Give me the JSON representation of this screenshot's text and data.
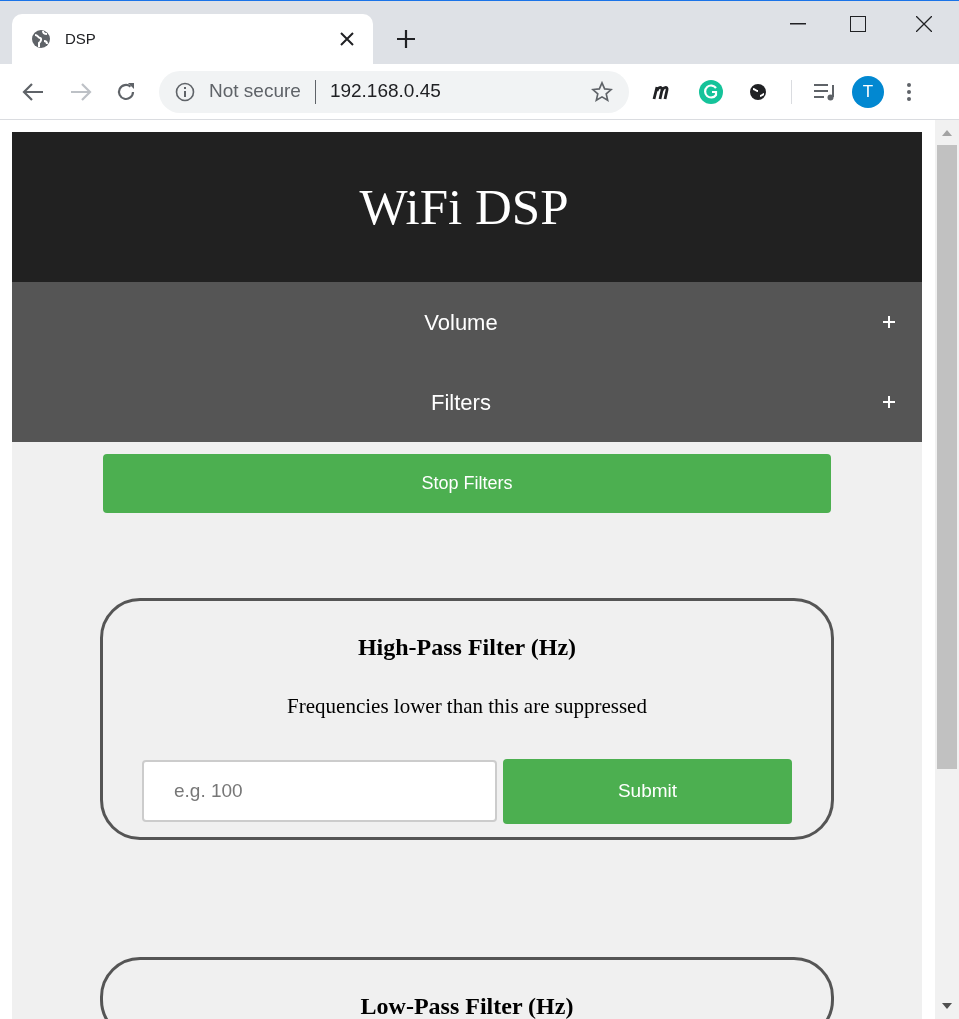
{
  "browser": {
    "tab": {
      "title": "DSP"
    },
    "address_bar": {
      "security_label": "Not secure",
      "url": "192.168.0.45"
    },
    "profile": {
      "initial": "T"
    }
  },
  "page": {
    "header": {
      "title": "WiFi DSP"
    },
    "accordion": [
      {
        "label": "Volume",
        "expanded": false
      },
      {
        "label": "Filters",
        "expanded": false
      }
    ],
    "stop_button": {
      "label": "Stop Filters"
    },
    "filter_cards": [
      {
        "title": "High-Pass Filter (Hz)",
        "description": "Frequencies lower than this are suppressed",
        "input": {
          "placeholder": "e.g. 100"
        },
        "button": "Submit"
      },
      {
        "title": "Low-Pass Filter (Hz)"
      }
    ]
  }
}
